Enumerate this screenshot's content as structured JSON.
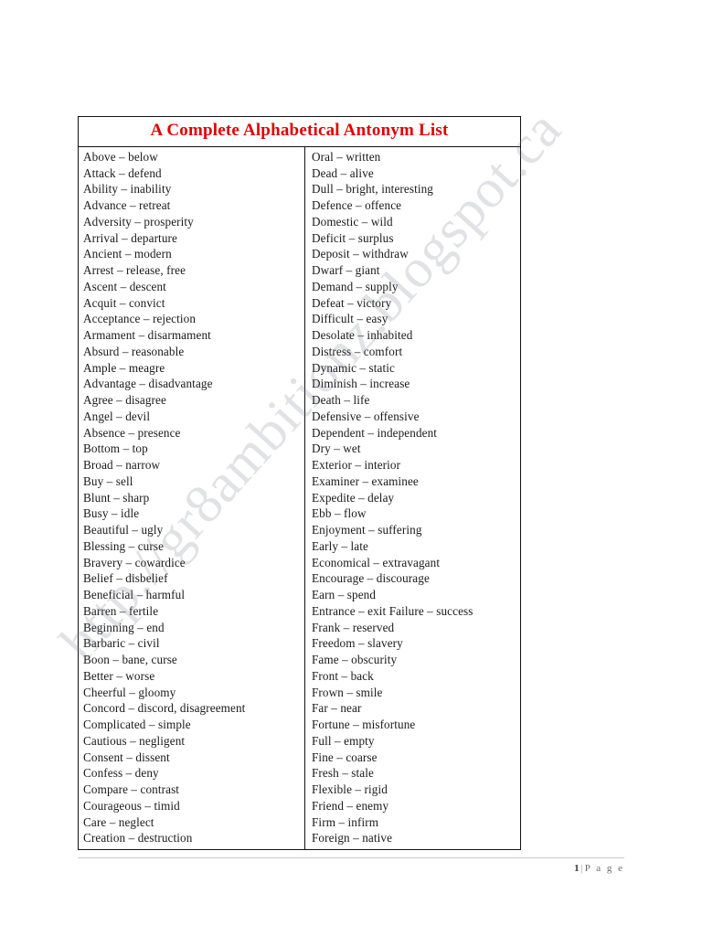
{
  "document": {
    "title": "A Complete Alphabetical Antonym List",
    "watermark": "http://gr8ambitionz.blogspot.ca",
    "title_color": "#e00000"
  },
  "table": {
    "left_column": [
      "Above – below",
      "Attack – defend",
      "Ability – inability",
      "Advance – retreat",
      "Adversity – prosperity",
      "Arrival – departure",
      "Ancient – modern",
      "Arrest – release, free",
      "Ascent – descent",
      "Acquit – convict",
      "Acceptance – rejection",
      "Armament – disarmament",
      "Absurd – reasonable",
      "Ample – meagre",
      "Advantage – disadvantage",
      "Agree – disagree",
      "Angel – devil",
      "Absence – presence",
      "Bottom – top",
      "Broad – narrow",
      "Buy – sell",
      "Blunt – sharp",
      "Busy – idle",
      "Beautiful – ugly",
      "Blessing – curse",
      "Bravery – cowardice",
      "Belief – disbelief",
      "Beneficial – harmful",
      "Barren – fertile",
      "Beginning – end",
      "Barbaric – civil",
      "Boon – bane, curse",
      "Better – worse",
      "Cheerful – gloomy",
      "Concord – discord, disagreement",
      "Complicated – simple",
      "Cautious – negligent",
      "Consent – dissent",
      "Confess – deny",
      "Compare – contrast",
      "Courageous – timid",
      "Care – neglect",
      "Creation – destruction"
    ],
    "right_column": [
      "Oral – written",
      "Dead – alive",
      "Dull – bright, interesting",
      "Defence – offence",
      "Domestic – wild",
      "Deficit – surplus",
      "Deposit – withdraw",
      "Dwarf – giant",
      "Demand – supply",
      "Defeat – victory",
      "Difficult – easy",
      "Desolate – inhabited",
      "Distress – comfort",
      "Dynamic – static",
      "Diminish – increase",
      "Death – life",
      "Defensive – offensive",
      "Dependent – independent",
      "Dry – wet",
      "Exterior – interior",
      "Examiner – examinee",
      "Expedite – delay",
      "Ebb – flow",
      "Enjoyment – suffering",
      "Early – late",
      "Economical – extravagant",
      "Encourage – discourage",
      "Earn – spend",
      "Entrance – exit Failure – success",
      "Frank – reserved",
      "Freedom – slavery",
      "Fame – obscurity",
      "Front – back",
      "Frown – smile",
      "Far – near",
      "Fortune – misfortune",
      "Full – empty",
      "Fine – coarse",
      "Fresh – stale",
      "Flexible – rigid",
      "Friend – enemy",
      "Firm – infirm",
      "Foreign – native"
    ]
  },
  "footer": {
    "page_number": "1",
    "separator": "|",
    "page_label": "P a g e"
  }
}
